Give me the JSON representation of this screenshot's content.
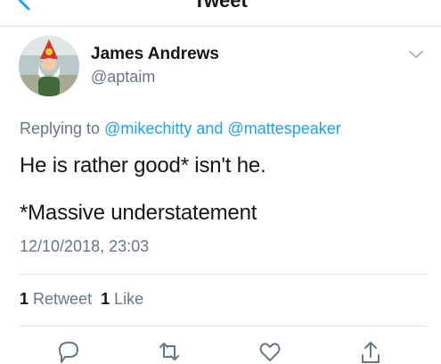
{
  "nav": {
    "title": "Tweet",
    "back_icon": "chevron-left-icon"
  },
  "tweet": {
    "author": {
      "name": "James Andrews",
      "handle": "@aptaim",
      "avatar": "garden-gnome-avatar"
    },
    "replying_to": {
      "prefix": "Replying to",
      "mention_1": "@mikechitty",
      "conjunction": "and",
      "mention_2": "@mattespeaker"
    },
    "text_line_1": "He is rather good* isn't he.",
    "text_line_2": "*Massive understatement",
    "timestamp": "12/10/2018, 23:03",
    "stats": {
      "retweet_count": "1",
      "retweet_label": "Retweet",
      "like_count": "1",
      "like_label": "Like"
    }
  },
  "actions": [
    {
      "name": "reply",
      "icon": "reply-icon"
    },
    {
      "name": "retweet",
      "icon": "retweet-icon"
    },
    {
      "name": "like",
      "icon": "heart-icon"
    },
    {
      "name": "share",
      "icon": "share-icon"
    }
  ],
  "colors": {
    "accent": "#1da1f2",
    "text": "#14171a",
    "secondary_text": "#657786",
    "divider": "#dfe3e8"
  }
}
